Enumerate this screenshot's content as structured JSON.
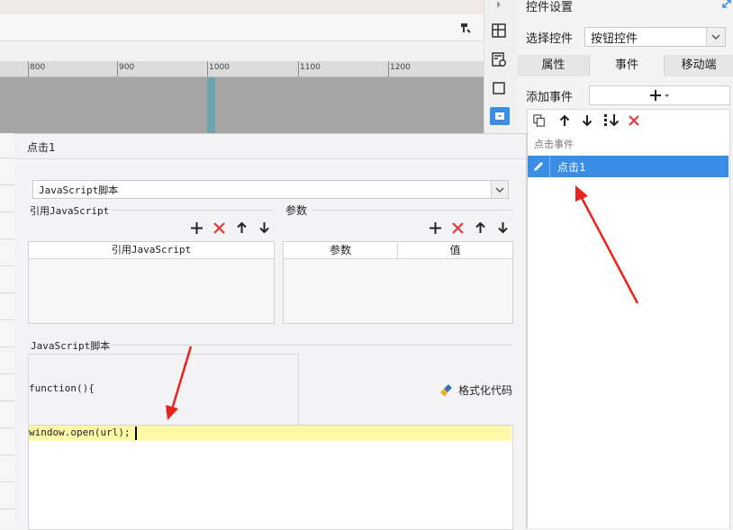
{
  "ruler": {
    "labels": [
      "800",
      "900",
      "1000",
      "1100",
      "1200"
    ]
  },
  "right_panel": {
    "title": "控件设置",
    "select_control_label": "选择控件",
    "select_control_value": "按钮控件",
    "tabs": [
      {
        "label": "属性",
        "active": false
      },
      {
        "label": "事件",
        "active": true
      },
      {
        "label": "移动端",
        "active": false
      }
    ],
    "add_event_label": "添加事件",
    "event_list_header": "点击事件",
    "event_item": "点击1"
  },
  "dialog": {
    "title": "点击1",
    "type_select_value": "JavaScript脚本",
    "ref_js_section": "引用JavaScript",
    "ref_js_column": "引用JavaScript",
    "params_section": "参数",
    "params_columns": [
      "参数",
      "值"
    ],
    "script_section": "JavaScript脚本",
    "function_header": "function(){",
    "format_code_label": "格式化代码",
    "code_line": "window.open(url);"
  },
  "colors": {
    "selection_blue": "#3a8ee6",
    "delete_red": "#e03a3a",
    "annotation_red": "#e8231b",
    "code_highlight": "#fff9a8"
  }
}
